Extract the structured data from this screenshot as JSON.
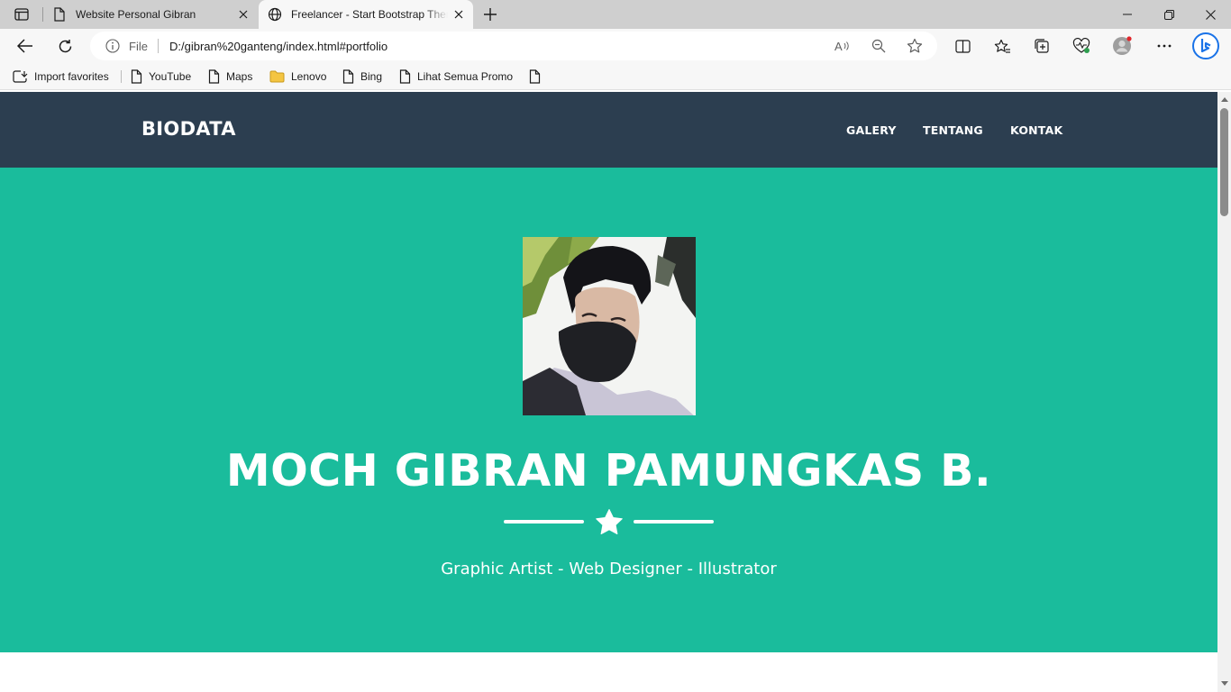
{
  "browser": {
    "tabs": [
      {
        "title": "Website Personal Gibran",
        "icon": "page-icon",
        "active": false
      },
      {
        "title": "Freelancer - Start Bootstrap Theme",
        "icon": "globe-icon",
        "active": true
      }
    ],
    "address": {
      "scheme_label": "File",
      "url": "D:/gibran%20ganteng/index.html#portfolio"
    },
    "favorites": [
      {
        "label": "Import favorites",
        "icon": "import-icon"
      },
      {
        "label": "YouTube",
        "icon": "page-icon"
      },
      {
        "label": "Maps",
        "icon": "page-icon"
      },
      {
        "label": "Lenovo",
        "icon": "folder-icon"
      },
      {
        "label": "Bing",
        "icon": "page-icon"
      },
      {
        "label": "Lihat Semua Promo",
        "icon": "page-icon"
      },
      {
        "label": "",
        "icon": "page-icon"
      }
    ]
  },
  "site": {
    "brand": "BIODATA",
    "nav": [
      "GALERY",
      "TENTANG",
      "KONTAK"
    ],
    "hero": {
      "name": "MOCH GIBRAN PAMUNGKAS B.",
      "subtitle": "Graphic Artist - Web Designer - Illustrator"
    }
  },
  "colors": {
    "navbar": "#2c3e50",
    "masthead": "#1abc9c",
    "text_light": "#ffffff"
  }
}
